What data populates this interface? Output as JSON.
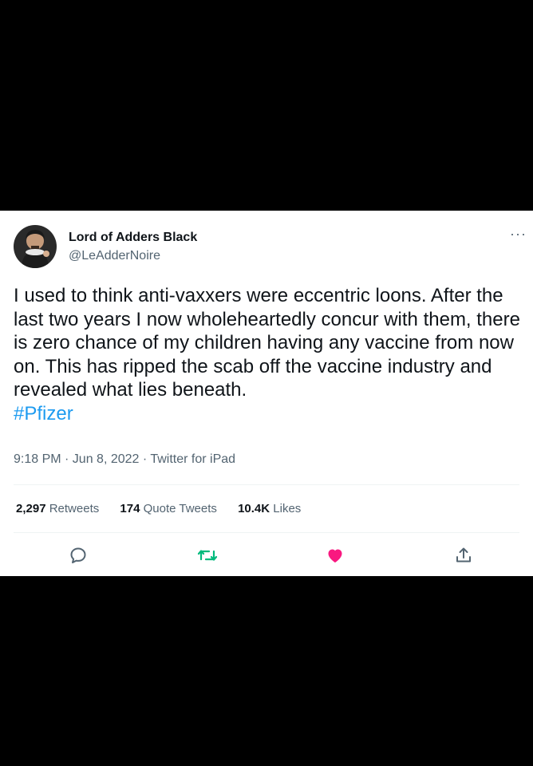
{
  "tweet": {
    "author": {
      "display_name": "Lord of Adders Black",
      "handle": "@LeAdderNoire"
    },
    "more_icon": "more-icon",
    "text_plain": "I used to think anti-vaxxers were eccentric loons. After the last two years I now wholeheartedly concur with them, there is zero chance of my children having any vaccine from now on. This has ripped the scab off the vaccine industry and revealed what lies beneath.",
    "hashtag": "#Pfizer",
    "meta": "9:18 PM · Jun 8, 2022 · Twitter for iPad",
    "stats": {
      "retweets_count": "2,297",
      "retweets_label": "Retweets",
      "quotes_count": "174",
      "quotes_label": "Quote Tweets",
      "likes_count": "10.4K",
      "likes_label": "Likes"
    },
    "actions": {
      "reply_icon": "reply-icon",
      "retweet_icon": "retweet-icon",
      "like_icon": "heart-icon",
      "share_icon": "share-icon"
    }
  },
  "colors": {
    "background": "#000000",
    "card": "#ffffff",
    "text": "#0f1419",
    "secondary": "#536471",
    "link": "#1d9bf0",
    "retweet": "#00ba7c",
    "like": "#f91880"
  }
}
